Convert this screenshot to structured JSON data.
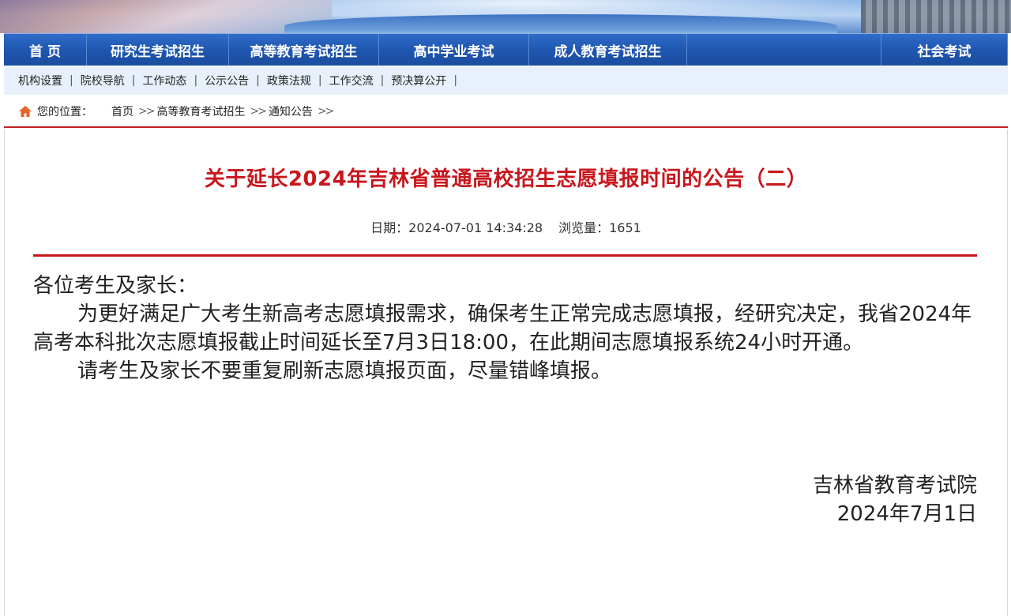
{
  "main_nav": [
    {
      "label": "首 页"
    },
    {
      "label": "研究生考试招生"
    },
    {
      "label": "高等教育考试招生"
    },
    {
      "label": "高中学业考试"
    },
    {
      "label": "成人教育考试招生"
    },
    {
      "label": "社会考试"
    }
  ],
  "sub_nav": [
    "机构设置",
    "院校导航",
    "工作动态",
    "公示公告",
    "政策法规",
    "工作交流",
    "预决算公开"
  ],
  "breadcrumb": {
    "prefix": "您的位置：",
    "items": [
      "首页",
      "高等教育考试招生",
      "通知公告"
    ]
  },
  "article": {
    "title": "关于延长2024年吉林省普通高校招生志愿填报时间的公告（二）",
    "date_label": "日期：2024-07-01 14:34:28",
    "views_label": "浏览量：1651",
    "salutation": "各位考生及家长：",
    "paragraph1": "为更好满足广大考生新高考志愿填报需求，确保考生正常完成志愿填报，经研究决定，我省2024年高考本科批次志愿填报截止时间延长至7月3日18:00，在此期间志愿填报系统24小时开通。",
    "paragraph2": "请考生及家长不要重复刷新志愿填报页面，尽量错峰填报。",
    "signature_org": "吉林省教育考试院",
    "signature_date": "2024年7月1日"
  },
  "colors": {
    "accent_red": "#c8161d",
    "nav_blue": "#1e55ae",
    "subnav_bg": "#e8f1fb"
  }
}
